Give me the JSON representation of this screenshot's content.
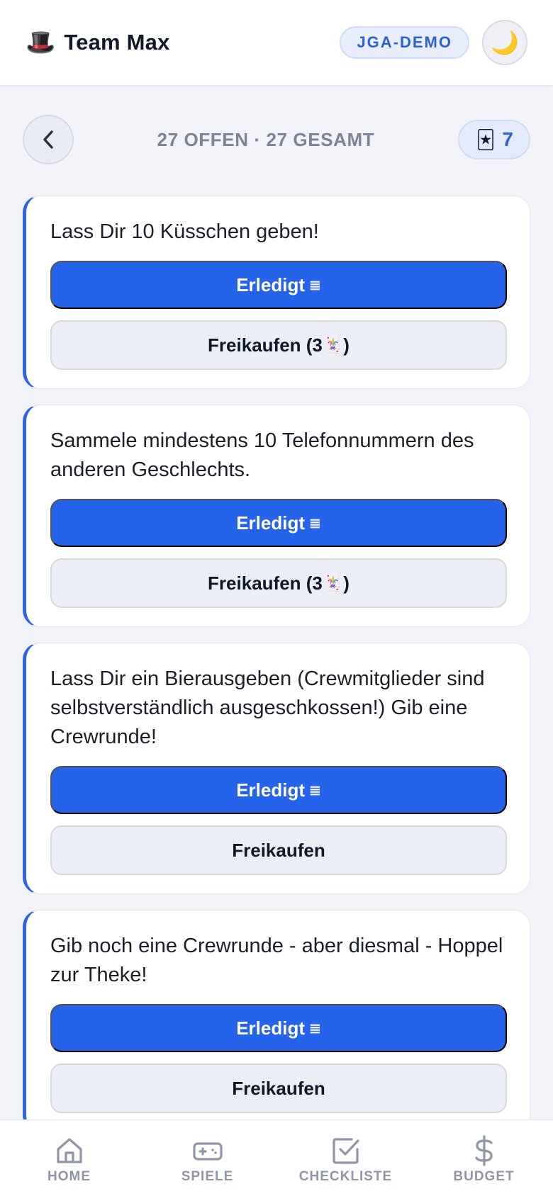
{
  "header": {
    "brand_emoji": "🎩",
    "title": "Team Max",
    "badge": "JGA-DEMO",
    "theme_icon": "🌙"
  },
  "status": {
    "counts": "27 OFFEN · 27 GESAMT",
    "joker_emoji": "🃏",
    "joker_count": "7"
  },
  "tasks": [
    {
      "text": "Lass Dir 10 Küsschen geben!",
      "done_label": "Erledigt",
      "done_glyph": "≣",
      "buyout_label": "Freikaufen (3",
      "buyout_glyph": "🃏",
      "buyout_suffix": ")"
    },
    {
      "text": "Sammele mindestens 10 Telefonnummern des anderen Geschlechts.",
      "done_label": "Erledigt",
      "done_glyph": "≣",
      "buyout_label": "Freikaufen (3",
      "buyout_glyph": "🃏",
      "buyout_suffix": ")"
    },
    {
      "text": "Lass Dir ein Bierausgeben (Crewmitglieder sind selbstverständlich ausgeschkossen!) Gib eine Crewrunde!",
      "done_label": "Erledigt",
      "done_glyph": "≣",
      "buyout_label": "Freikaufen",
      "buyout_glyph": "",
      "buyout_suffix": ""
    },
    {
      "text": "Gib noch eine Crewrunde - aber diesmal - Hoppel zur Theke!",
      "done_label": "Erledigt",
      "done_glyph": "≣",
      "buyout_label": "Freikaufen",
      "buyout_glyph": "",
      "buyout_suffix": ""
    }
  ],
  "nav": {
    "items": [
      {
        "label": "HOME",
        "icon": "home-icon"
      },
      {
        "label": "SPIELE",
        "icon": "gamepad-icon"
      },
      {
        "label": "CHECKLISTE",
        "icon": "checkbox-icon"
      },
      {
        "label": "BUDGET",
        "icon": "dollar-icon"
      }
    ]
  },
  "colors": {
    "accent": "#2563eb",
    "background": "#f1f3f9",
    "muted": "#9096a8"
  }
}
